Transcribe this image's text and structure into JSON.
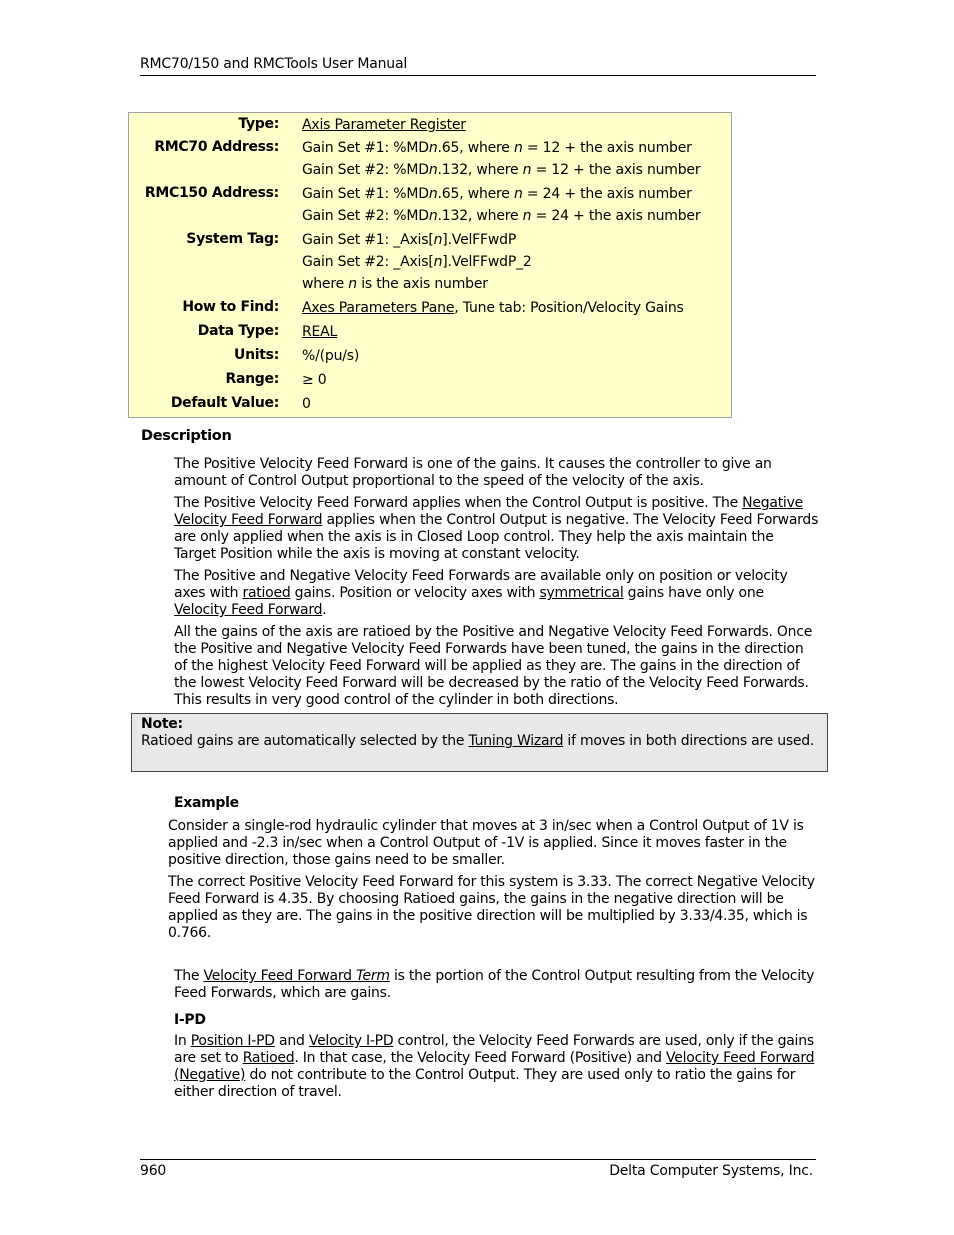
{
  "header": {
    "title": "RMC70/150 and RMCTools User Manual"
  },
  "footer": {
    "page_number": "960",
    "company": "Delta Computer Systems, Inc."
  },
  "properties": {
    "type_label": "Type:",
    "type_value": "Axis Parameter Register",
    "rmc70_label": "RMC70 Address:",
    "rmc70_line1": {
      "pre": "Gain Set #1: %MD",
      "n": "n",
      "mid": ".65, where ",
      "n2": "n",
      "post": " = 12 + the axis number"
    },
    "rmc70_line2": {
      "pre": "Gain Set #2: %MD",
      "n": "n",
      "mid": ".132, where ",
      "n2": "n",
      "post": " = 12 + the axis number"
    },
    "rmc150_label": "RMC150 Address:",
    "rmc150_line1": {
      "pre": "Gain Set #1: %MD",
      "n": "n",
      "mid": ".65, where ",
      "n2": "n",
      "post": " = 24 + the axis number"
    },
    "rmc150_line2": {
      "pre": "Gain Set #2: %MD",
      "n": "n",
      "mid": ".132, where ",
      "n2": "n",
      "post": " = 24 + the axis number"
    },
    "systag_label": "System Tag:",
    "systag_line1": {
      "pre": "Gain Set #1: _Axis[",
      "n": "n",
      "post": "].VelFFwdP"
    },
    "systag_line2": {
      "pre": "Gain Set #2: _Axis[",
      "n": "n",
      "post": "].VelFFwdP_2"
    },
    "systag_line3": {
      "pre": "where ",
      "n": "n",
      "post": " is the axis number"
    },
    "howto_label": "How to Find:",
    "howto_link": "Axes Parameters Pane",
    "howto_rest": ", Tune tab: Position/Velocity Gains",
    "datatype_label": "Data Type:",
    "datatype_value": "REAL",
    "units_label": "Units:",
    "units_value": "%/(pu/s)",
    "range_label": "Range:",
    "range_value": "≥ 0",
    "default_label": "Default Value:",
    "default_value": "0"
  },
  "description": {
    "heading": "Description",
    "p1": "The Positive Velocity Feed Forward is one of the gains. It causes the controller to give an amount of Control Output proportional to the speed of the velocity of the axis.",
    "p2_a": "The Positive Velocity Feed Forward applies when the Control Output is positive. The ",
    "p2_link": "Negative Velocity Feed Forward",
    "p2_b": " applies when the Control Output is negative. The Velocity Feed Forwards are only applied when the axis is in Closed Loop control. They help the axis maintain the Target Position while the axis is moving at constant velocity.",
    "p3_a": "The Positive and Negative Velocity Feed Forwards are available only on position or velocity axes with ",
    "p3_link1": "ratioed",
    "p3_b": " gains. Position or velocity axes with ",
    "p3_link2": "symmetrical",
    "p3_c": " gains have only one ",
    "p3_link3": "Velocity Feed Forward",
    "p3_d": ".",
    "p4": "All the gains of the axis are ratioed by the Positive and Negative Velocity Feed Forwards. Once the Positive and Negative Velocity Feed Forwards have been tuned, the gains in the direction of the highest Velocity Feed Forward will be applied as they are. The gains in the direction of the lowest Velocity Feed Forward will be decreased by the ratio of the Velocity Feed Forwards. This results in very good control of the cylinder in both directions."
  },
  "note": {
    "title": "Note:",
    "text_a": "Ratioed gains are automatically selected by the ",
    "link": "Tuning Wizard",
    "text_b": " if moves in both directions are used."
  },
  "example": {
    "heading": "Example",
    "p1": "Consider a single-rod hydraulic cylinder that moves at 3 in/sec when a Control Output of 1V is applied and -2.3 in/sec when a Control Output of -1V is applied. Since it moves faster in the positive direction, those gains need to be smaller.",
    "p2": "The correct Positive Velocity Feed Forward for this system is 3.33. The correct Negative Velocity Feed Forward is 4.35. By choosing Ratioed gains, the gains in the negative direction will be applied as they are. The gains in the positive direction will be multiplied by 3.33/4.35, which is 0.766."
  },
  "term": {
    "a": "The ",
    "link": "Velocity Feed Forward ",
    "link_italic": "Term",
    "b": " is the portion of the Control Output resulting from the Velocity Feed Forwards, which are gains."
  },
  "ipd": {
    "heading": "I-PD",
    "a": "In ",
    "link1": "Position I-PD",
    "b": " and ",
    "link2": "Velocity I-PD",
    "c": " control, the Velocity Feed Forwards are used, only if the gains are set to ",
    "link3": "Ratioed",
    "d": ". In that case, the Velocity Feed Forward (Positive) and ",
    "link4": "Velocity Feed Forward (Negative)",
    "e": " do not contribute to the Control Output. They are used only to ratio the gains for either direction of travel."
  }
}
